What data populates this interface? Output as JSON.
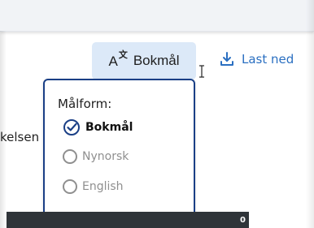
{
  "header": {
    "language_button_label": "Bokmål",
    "language_icon": "translate-icon",
    "download_label": "Last ned",
    "download_icon": "download-icon"
  },
  "language_menu": {
    "title": "Målform:",
    "options": [
      {
        "label": "Bokmål",
        "selected": true
      },
      {
        "label": "Nynorsk",
        "selected": false
      },
      {
        "label": "English",
        "selected": false
      }
    ]
  },
  "background": {
    "partial_text": "kelsen",
    "bottom_bar_text": "0"
  },
  "colors": {
    "accent": "#1a3f86",
    "button_bg": "#dce9f8",
    "link": "#2a6fc1",
    "muted": "#8f8f8f"
  }
}
